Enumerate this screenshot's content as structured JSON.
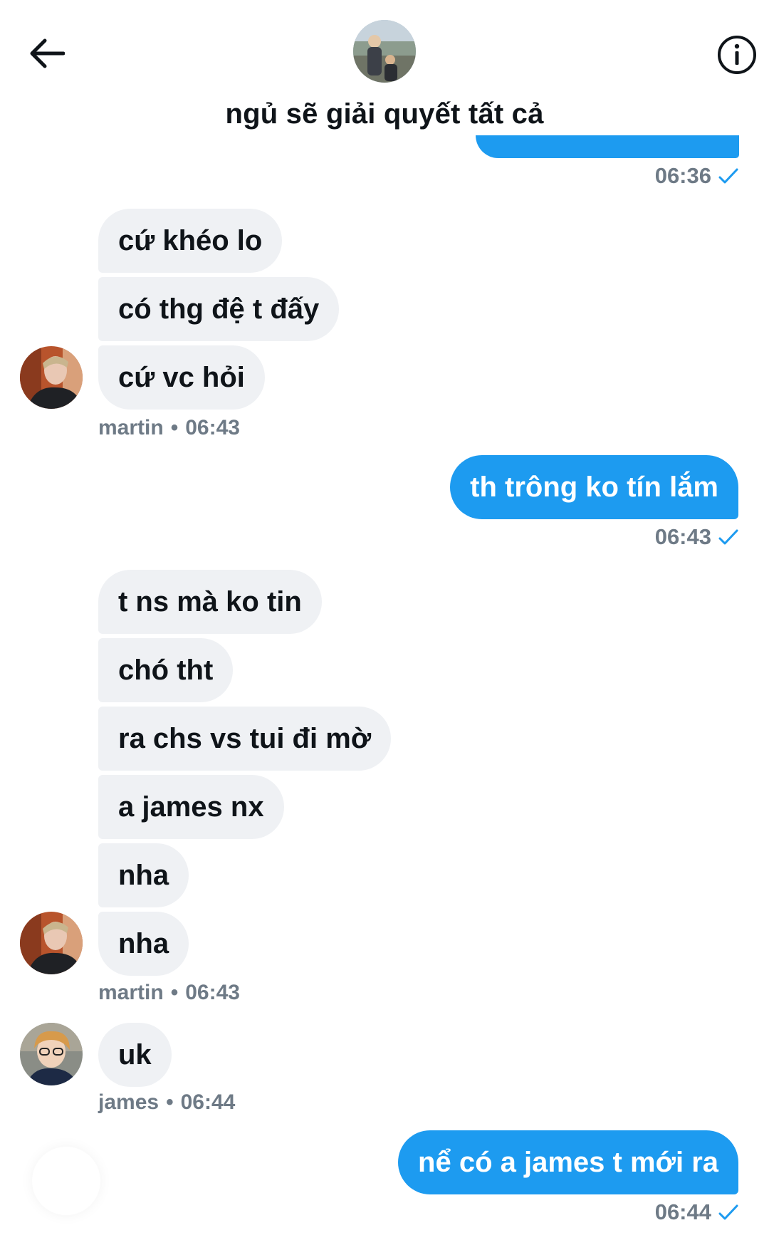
{
  "header": {
    "title": "ngủ sẽ giải quyết tất cả",
    "back_icon": "arrow-left-icon",
    "info_icon": "info-circle-icon"
  },
  "colors": {
    "sent_bubble": "#1d9bf0",
    "received_bubble": "#eff1f4",
    "meta_text": "#6e7a86",
    "check": "#1d9bf0"
  },
  "messages": {
    "top_time": "06:36",
    "group1": {
      "items": [
        "cứ khéo lo",
        "có thg đệ t đấy",
        "cứ vc hỏi"
      ],
      "sender": "martin",
      "time": "06:43"
    },
    "sent1": {
      "text": "th trông ko tín lắm",
      "time": "06:43"
    },
    "group2": {
      "items": [
        "t ns mà ko tin",
        "chó tht",
        "ra chs vs tui đi mờ",
        "a james nx",
        "nha",
        "nha"
      ],
      "sender": "martin",
      "time": "06:43"
    },
    "group3": {
      "items": [
        "uk"
      ],
      "sender": "james",
      "time": "06:44"
    },
    "sent2": {
      "text": "nể có a james t mới ra",
      "time": "06:44"
    }
  }
}
